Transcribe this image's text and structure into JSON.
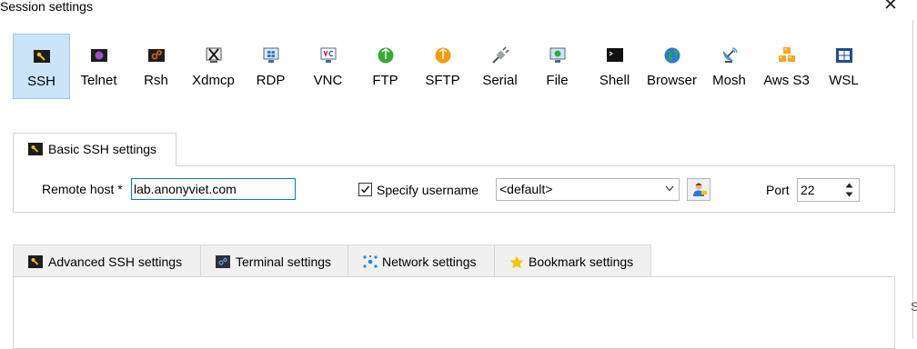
{
  "window": {
    "title": "Session settings",
    "close_glyph": "✕"
  },
  "edge_text": "S",
  "session_types": [
    {
      "label": "SSH",
      "icon": "ssh-key-icon",
      "selected": true
    },
    {
      "label": "Telnet",
      "icon": "telnet-icon"
    },
    {
      "label": "Rsh",
      "icon": "rsh-icon"
    },
    {
      "label": "Xdmcp",
      "icon": "xdmcp-icon"
    },
    {
      "label": "RDP",
      "icon": "rdp-icon"
    },
    {
      "label": "VNC",
      "icon": "vnc-icon"
    },
    {
      "label": "FTP",
      "icon": "ftp-icon"
    },
    {
      "label": "SFTP",
      "icon": "sftp-icon"
    },
    {
      "label": "Serial",
      "icon": "serial-plug-icon"
    },
    {
      "label": "File",
      "icon": "file-icon"
    },
    {
      "label": "Shell",
      "icon": "shell-terminal-icon"
    },
    {
      "label": "Browser",
      "icon": "browser-globe-icon"
    },
    {
      "label": "Mosh",
      "icon": "mosh-satellite-icon"
    },
    {
      "label": "Aws S3",
      "icon": "aws-s3-icon"
    },
    {
      "label": "WSL",
      "icon": "wsl-windows-icon"
    }
  ],
  "basic": {
    "tab_label": "Basic SSH settings",
    "remote_host_label": "Remote host *",
    "remote_host_value": "lab.anonyviet.com",
    "specify_username_label": "Specify username",
    "specify_username_checked": true,
    "username_value": "<default>",
    "port_label": "Port",
    "port_value": "22"
  },
  "bottom_tabs": [
    {
      "label": "Advanced SSH settings",
      "icon": "ssh-key-icon"
    },
    {
      "label": "Terminal settings",
      "icon": "terminal-icon"
    },
    {
      "label": "Network settings",
      "icon": "network-icon"
    },
    {
      "label": "Bookmark settings",
      "icon": "star-icon"
    }
  ],
  "colors": {
    "selected_bg": "#cce4f7",
    "focus_border": "#0078d7",
    "star": "#f5c400"
  }
}
